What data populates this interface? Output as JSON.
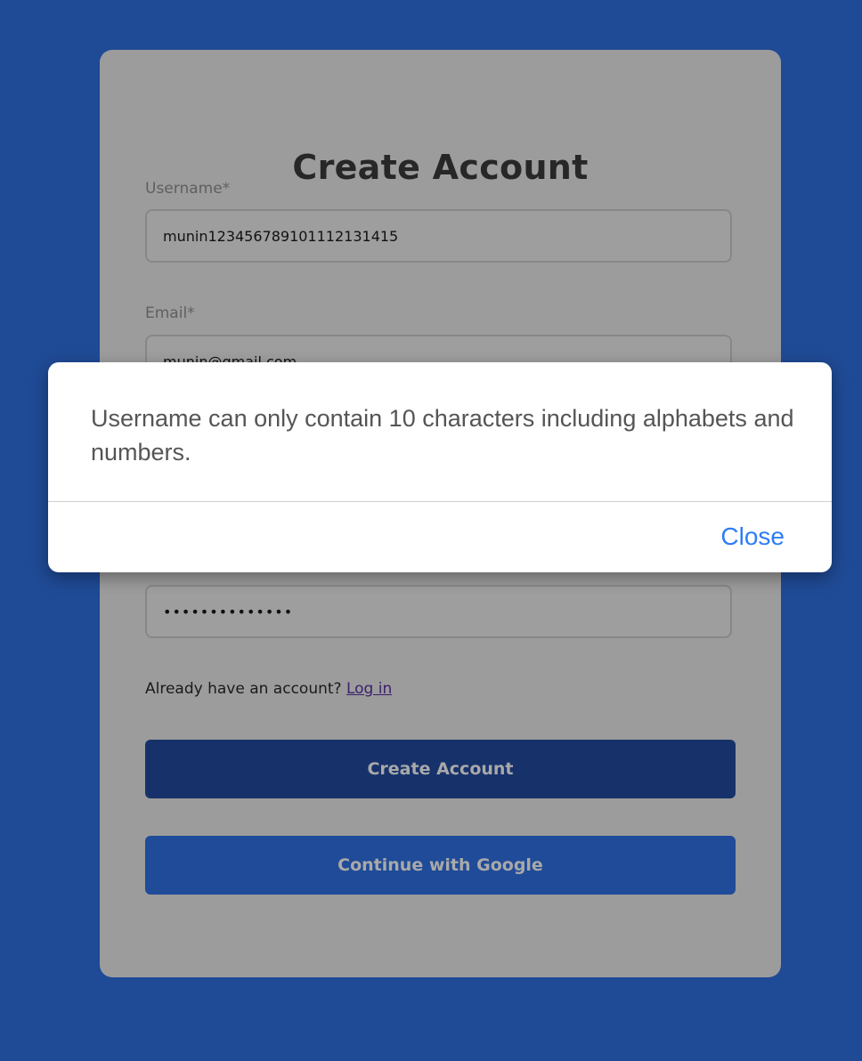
{
  "form": {
    "title": "Create Account",
    "username_label": "Username*",
    "username_value": "munin123456789101112131415",
    "email_label": "Email*",
    "email_value": "munin@gmail.com",
    "password_value": "••••••••••••••",
    "login_prompt": "Already have an account?",
    "login_link": "Log in",
    "create_button": "Create Account",
    "google_button": "Continue with Google"
  },
  "dialog": {
    "message": "Username can only contain 10 characters including alphabets and numbers.",
    "close_label": "Close"
  },
  "colors": {
    "page_background": "#1f4a95",
    "link_blue": "#2f7cf6"
  }
}
